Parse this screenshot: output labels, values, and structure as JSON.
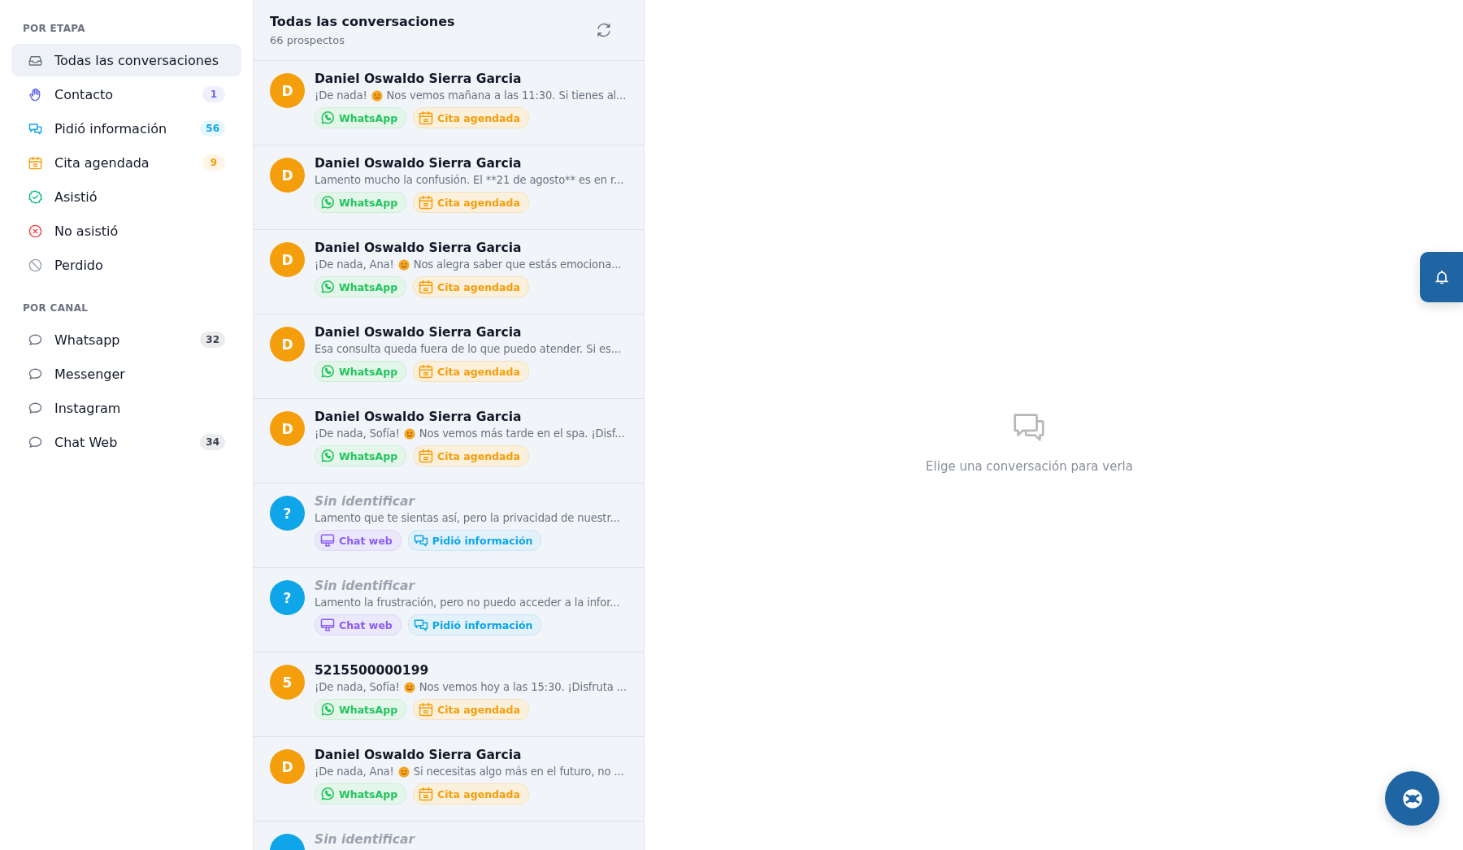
{
  "sidebar": {
    "sections": [
      {
        "heading": "POR ETAPA",
        "items": [
          {
            "label": "Todas las conversaciones",
            "kind": "inbox",
            "selected": true
          },
          {
            "label": "Contacto",
            "kind": "hand",
            "selected": false,
            "count": "1",
            "color": "#6366f1"
          },
          {
            "label": "Pidió información",
            "kind": "chat",
            "selected": false,
            "count": "56",
            "color": "#0ea5e9"
          },
          {
            "label": "Cita agendada",
            "kind": "calendar",
            "selected": false,
            "count": "9",
            "color": "#f59e0b"
          },
          {
            "label": "Asistió",
            "kind": "check",
            "selected": false
          },
          {
            "label": "No asistió",
            "kind": "cross",
            "selected": false
          },
          {
            "label": "Perdido",
            "kind": "ban",
            "selected": false
          }
        ]
      },
      {
        "heading": "POR CANAL",
        "items": [
          {
            "label": "Whatsapp",
            "kind": "bubble",
            "selected": false,
            "count": "32",
            "color": "#374151"
          },
          {
            "label": "Messenger",
            "kind": "bubble",
            "selected": false
          },
          {
            "label": "Instagram",
            "kind": "bubble",
            "selected": false
          },
          {
            "label": "Chat Web",
            "kind": "bubble",
            "selected": false,
            "count": "34",
            "color": "#374151"
          }
        ]
      }
    ]
  },
  "list": {
    "title": "Todas las conversaciones",
    "subtitle": "66 prospectos",
    "conversations": [
      {
        "initial": "D",
        "color": "#f59e0b",
        "name": "Daniel Oswaldo Sierra Garcia",
        "identified": true,
        "preview_parts": [
          "¡De nada!",
          "Nos vemos mañana a las 11:30. Si tienes al..."
        ],
        "tags": [
          {
            "kind": "whatsapp",
            "label": "WhatsApp"
          },
          {
            "kind": "cita",
            "label": "Cita agendada"
          }
        ]
      },
      {
        "initial": "D",
        "color": "#f59e0b",
        "name": "Daniel Oswaldo Sierra Garcia",
        "identified": true,
        "preview_parts": [
          "Lamento mucho la confusión. El **21 de agosto** es en r..."
        ],
        "tags": [
          {
            "kind": "whatsapp",
            "label": "WhatsApp"
          },
          {
            "kind": "cita",
            "label": "Cita agendada"
          }
        ]
      },
      {
        "initial": "D",
        "color": "#f59e0b",
        "name": "Daniel Oswaldo Sierra Garcia",
        "identified": true,
        "preview_parts": [
          "¡De nada, Ana!",
          "Nos alegra saber que estás emociona..."
        ],
        "tags": [
          {
            "kind": "whatsapp",
            "label": "WhatsApp"
          },
          {
            "kind": "cita",
            "label": "Cita agendada"
          }
        ]
      },
      {
        "initial": "D",
        "color": "#f59e0b",
        "name": "Daniel Oswaldo Sierra Garcia",
        "identified": true,
        "preview_parts": [
          "Esa consulta queda fuera de lo que puedo atender. Si es..."
        ],
        "tags": [
          {
            "kind": "whatsapp",
            "label": "WhatsApp"
          },
          {
            "kind": "cita",
            "label": "Cita agendada"
          }
        ]
      },
      {
        "initial": "D",
        "color": "#f59e0b",
        "name": "Daniel Oswaldo Sierra Garcia",
        "identified": true,
        "preview_parts": [
          "¡De nada, Sofía!",
          "Nos vemos más tarde en el spa. ¡Disf..."
        ],
        "tags": [
          {
            "kind": "whatsapp",
            "label": "WhatsApp"
          },
          {
            "kind": "cita",
            "label": "Cita agendada"
          }
        ]
      },
      {
        "initial": "?",
        "color": "#0ea5e9",
        "name": "Sin identificar",
        "identified": false,
        "preview_parts": [
          "Lamento que te sientas así, pero la privacidad de nuestr..."
        ],
        "tags": [
          {
            "kind": "chatweb",
            "label": "Chat web"
          },
          {
            "kind": "pidio",
            "label": "Pidió información"
          }
        ]
      },
      {
        "initial": "?",
        "color": "#0ea5e9",
        "name": "Sin identificar",
        "identified": false,
        "preview_parts": [
          "Lamento la frustración, pero no puedo acceder a la infor..."
        ],
        "tags": [
          {
            "kind": "chatweb",
            "label": "Chat web"
          },
          {
            "kind": "pidio",
            "label": "Pidió información"
          }
        ]
      },
      {
        "initial": "5",
        "color": "#f59e0b",
        "name": "5215500000199",
        "identified": true,
        "preview_parts": [
          "¡De nada, Sofía!",
          "Nos vemos hoy a las 15:30. ¡Disfruta ..."
        ],
        "tags": [
          {
            "kind": "whatsapp",
            "label": "WhatsApp"
          },
          {
            "kind": "cita",
            "label": "Cita agendada"
          }
        ]
      },
      {
        "initial": "D",
        "color": "#f59e0b",
        "name": "Daniel Oswaldo Sierra Garcia",
        "identified": true,
        "preview_parts": [
          "¡De nada, Ana!",
          "Si necesitas algo más en el futuro, no ..."
        ],
        "tags": [
          {
            "kind": "whatsapp",
            "label": "WhatsApp"
          },
          {
            "kind": "cita",
            "label": "Cita agendada"
          }
        ]
      },
      {
        "color": "#0ea5e9",
        "name": "Sin identificar",
        "identified": false
      }
    ]
  },
  "empty_state": {
    "message": "Elige una conversación para verla"
  }
}
